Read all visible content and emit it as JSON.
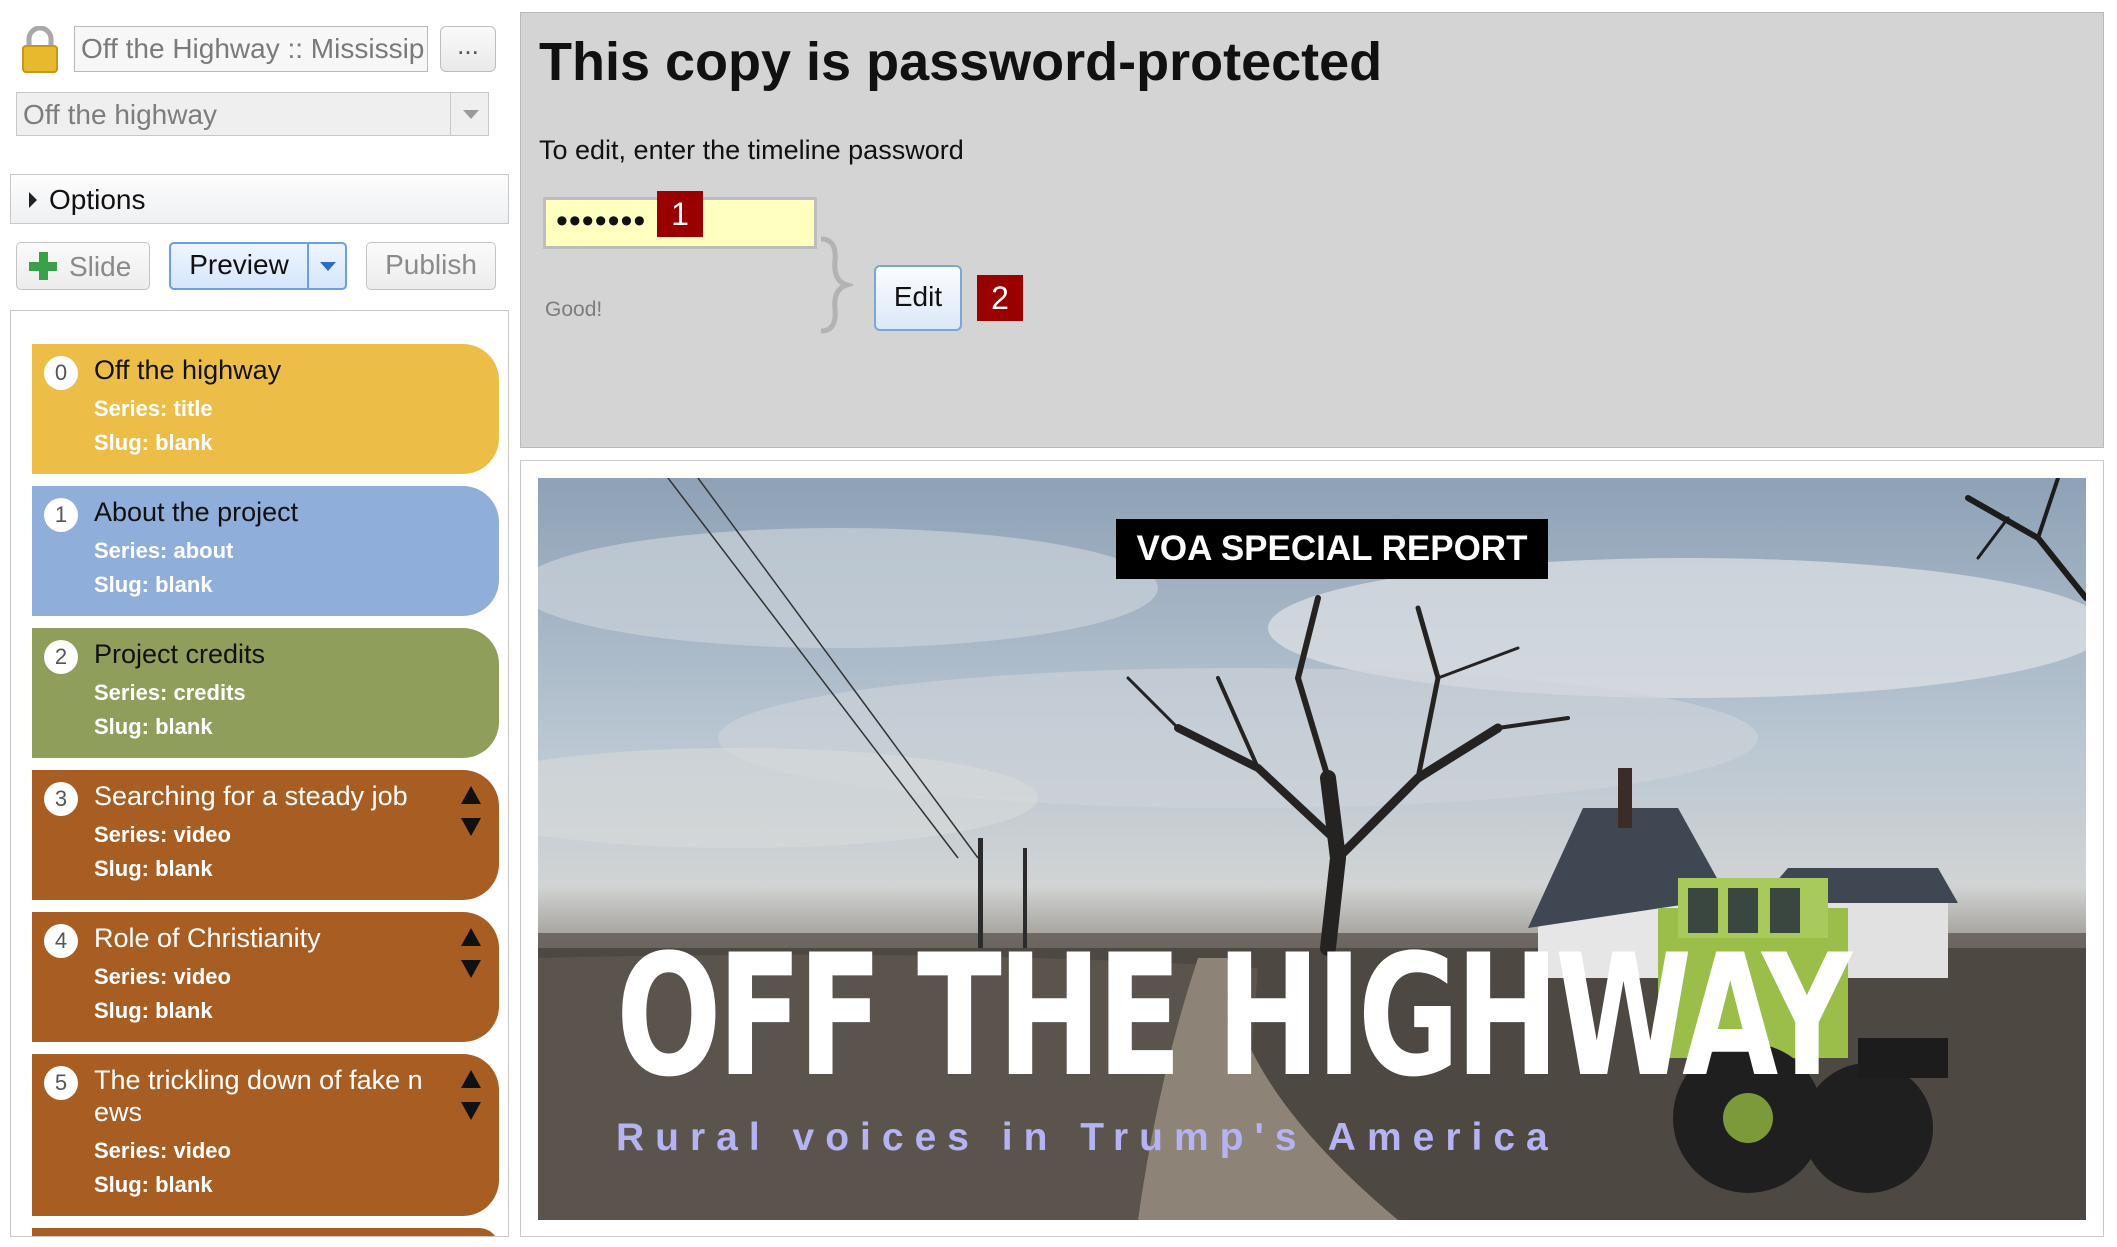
{
  "sidebar": {
    "title_input_value": "Off the Highway :: Mississip",
    "more_button_label": "...",
    "timeline_select_value": "Off the highway",
    "options_label": "Options",
    "toolbar": {
      "slide_label": "Slide",
      "preview_label": "Preview",
      "publish_label": "Publish"
    },
    "slides": [
      {
        "num": "0",
        "title": "Off the highway",
        "series": "Series: title",
        "slug": "Slug: blank",
        "color": "#ECBE47"
      },
      {
        "num": "1",
        "title": "About the project",
        "series": "Series: about",
        "slug": "Slug: blank",
        "color": "#90AEDA"
      },
      {
        "num": "2",
        "title": "Project credits",
        "series": "Series: credits",
        "slug": "Slug: blank",
        "color": "#909E5B"
      },
      {
        "num": "3",
        "title": "Searching for a steady job",
        "series": "Series: video",
        "slug": "Slug: blank",
        "color": "#A85E23"
      },
      {
        "num": "4",
        "title": "Role of Christianity",
        "series": "Series: video",
        "slug": "Slug: blank",
        "color": "#A85E23"
      },
      {
        "num": "5",
        "title": "The trickling down of fake n ews",
        "series": "Series: video",
        "slug": "Slug: blank",
        "color": "#A85E23"
      }
    ]
  },
  "password_panel": {
    "heading": "This copy is password-protected",
    "instruction": "To edit, enter the timeline password",
    "password_value": "•••••••",
    "status": "Good!",
    "edit_label": "Edit",
    "markers": [
      "1",
      "2"
    ]
  },
  "preview": {
    "badge": "VOA SPECIAL REPORT",
    "title": "OFF THE HIGHWAY",
    "subtitle": "Rural voices in Trump's America"
  },
  "colors": {
    "panel_bg": "#D4D4D4",
    "marker_red": "#9B0000",
    "password_bg": "#FFFFC0",
    "accent_blue": "#6B9FE0"
  },
  "icons": [
    "lock-icon",
    "plus-icon",
    "chevron-down-icon",
    "triangle-right-icon",
    "arrow-up-icon",
    "arrow-down-icon"
  ]
}
